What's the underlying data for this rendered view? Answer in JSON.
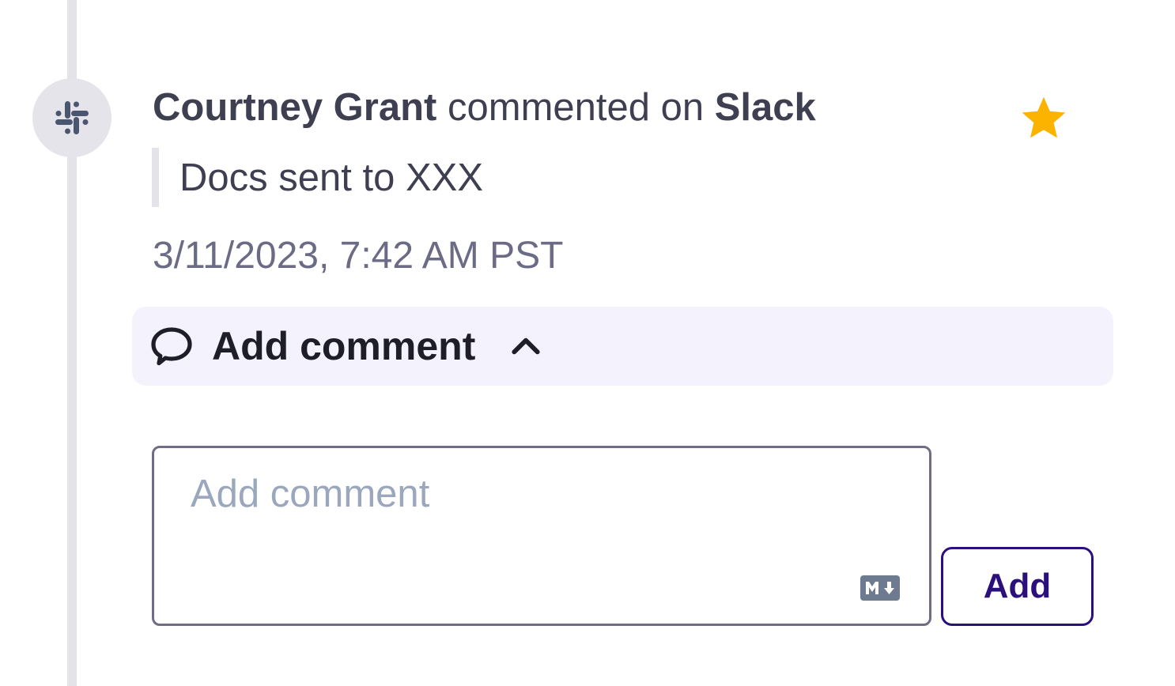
{
  "activity": {
    "source_icon": "slack-icon",
    "author": "Courtney Grant",
    "action_text": "commented on",
    "source_name": "Slack",
    "quote": "Docs sent to XXX",
    "timestamp": "3/11/2023, 7:42 AM PST",
    "starred": true,
    "star_icon": "star-icon",
    "star_color": "#fbb300"
  },
  "comment_section": {
    "toggle_icon": "chat-bubble-icon",
    "toggle_label": "Add comment",
    "toggle_chevron_icon": "chevron-up-icon",
    "expanded": true,
    "input_placeholder": "Add comment",
    "input_value": "",
    "markdown_icon": "markdown-icon",
    "submit_label": "Add"
  },
  "colors": {
    "toggle_background": "#f3f2fd",
    "button_accent": "#2a0f7d"
  }
}
